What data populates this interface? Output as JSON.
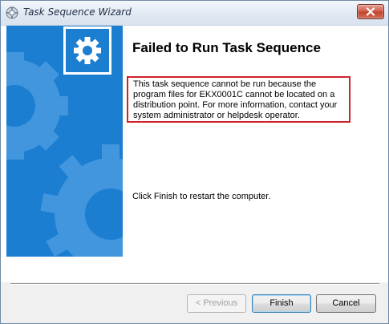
{
  "window": {
    "title": "Task Sequence Wizard",
    "icon": "task-sequence-app-icon",
    "close_icon": "close-icon"
  },
  "sidebar": {
    "accent_color": "#1b7ed1",
    "icon": "gear-icon"
  },
  "main": {
    "heading": "Failed to Run Task Sequence",
    "error_message": "This task sequence cannot be run because the program files for EKX0001C cannot be located on a distribution point. For more information, contact your system administrator or helpdesk operator.",
    "error_border_color": "#d0212e",
    "finish_note": "Click Finish to restart the computer."
  },
  "buttons": {
    "previous": "< Previous",
    "finish": "Finish",
    "cancel": "Cancel"
  }
}
